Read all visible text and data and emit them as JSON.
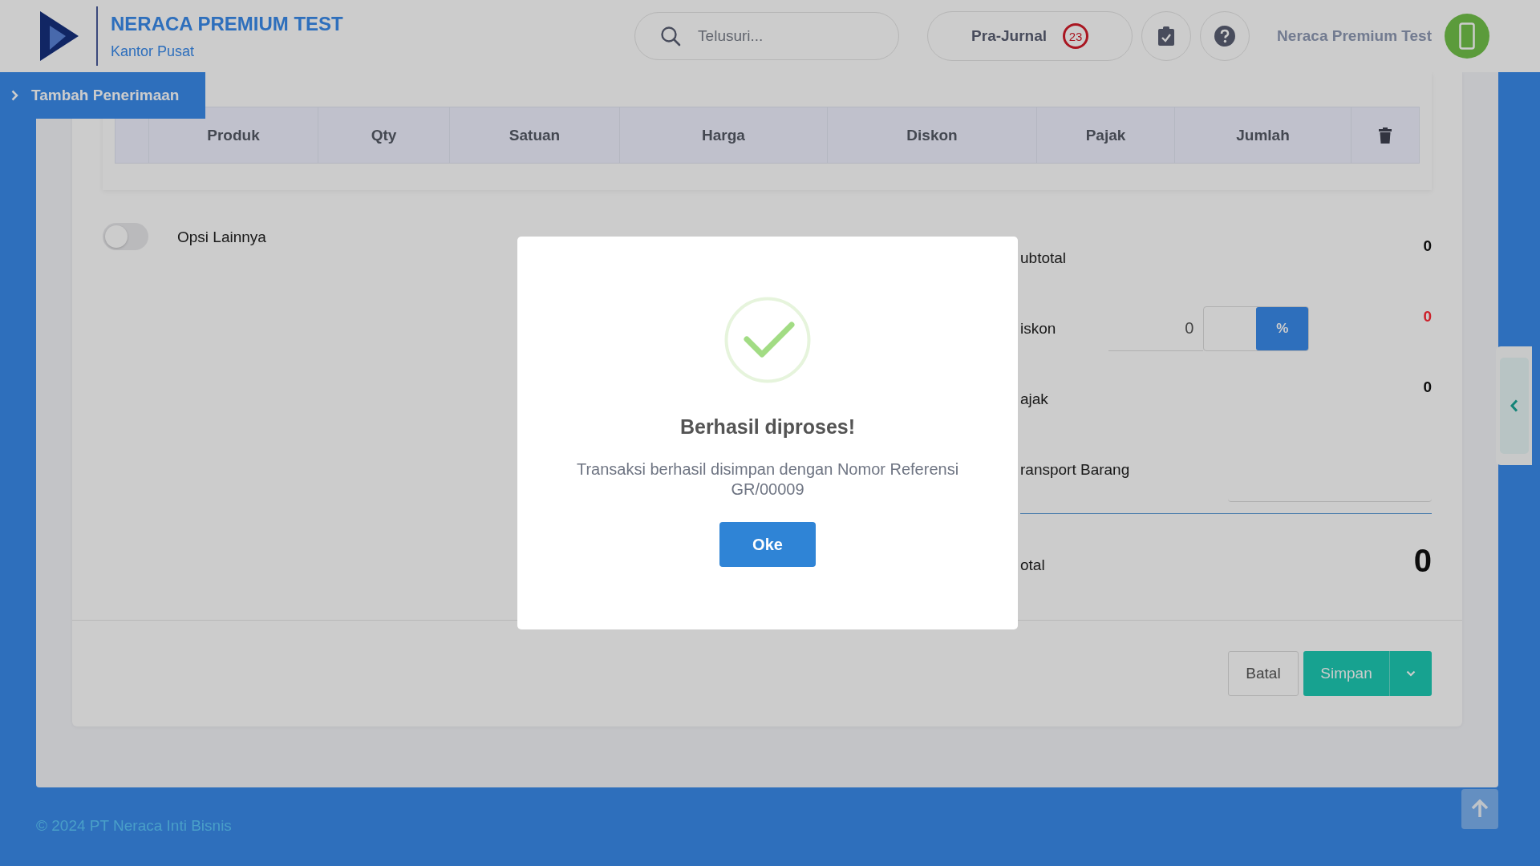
{
  "header": {
    "company": "NERACA PREMIUM TEST",
    "branch": "Kantor Pusat",
    "search": {
      "placeholder": "Telusuri..."
    },
    "pra_jurnal": {
      "label": "Pra-Jurnal",
      "count": "23"
    },
    "user_name": "Neraca Premium Test"
  },
  "page_tab": {
    "label": "Tambah Penerimaan"
  },
  "table": {
    "columns": [
      "Produk",
      "Qty",
      "Satuan",
      "Harga",
      "Diskon",
      "Pajak",
      "Jumlah"
    ]
  },
  "options_toggle": {
    "label": "Opsi Lainnya",
    "on": false
  },
  "summary": {
    "rows": [
      {
        "kind": "plain",
        "label": "ubtotal",
        "value": "0"
      },
      {
        "kind": "discount",
        "label": "iskon",
        "input_value": "0",
        "unit": "%",
        "value": "0"
      },
      {
        "kind": "plain",
        "label": "ajak",
        "value": "0"
      },
      {
        "kind": "input",
        "label": "ransport Barang"
      }
    ],
    "total": {
      "label": "otal",
      "value": "0"
    }
  },
  "actions": {
    "cancel": "Batal",
    "save": "Simpan"
  },
  "footer": {
    "copyright": "© 2024 PT Neraca Inti Bisnis"
  },
  "modal": {
    "title": "Berhasil diproses!",
    "message": "Transaksi berhasil disimpan dengan Nomor Referensi GR/00009",
    "button": "Oke"
  }
}
